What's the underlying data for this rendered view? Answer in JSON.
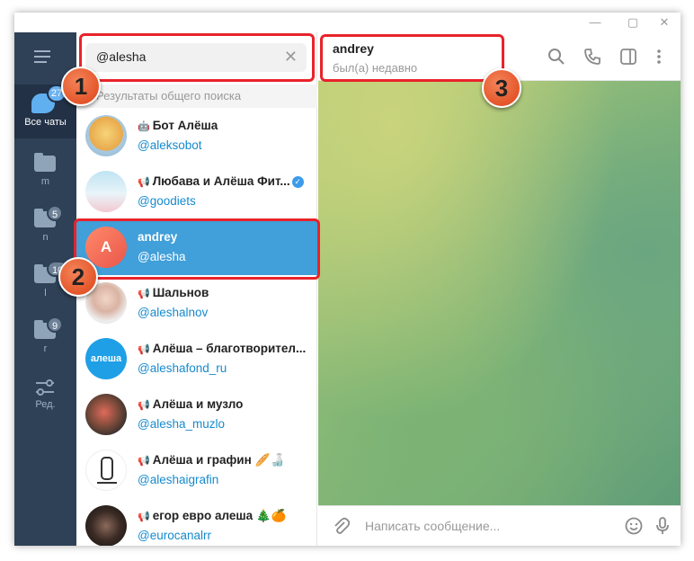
{
  "window": {
    "min_icon": "minimize-icon",
    "max_icon": "maximize-icon",
    "close_icon": "close-icon"
  },
  "folders": {
    "all_chats": {
      "label": "Все чаты",
      "badge": "27"
    },
    "items": [
      {
        "label": "m",
        "badge": ""
      },
      {
        "label": "n",
        "badge": "5"
      },
      {
        "label": "l",
        "badge": "10"
      },
      {
        "label": "r",
        "badge": "9"
      }
    ],
    "edit_label": "Ред."
  },
  "search": {
    "value": "@alesha",
    "section_title": "Результаты общего поиска"
  },
  "results": [
    {
      "name": "Бот Алёша",
      "username": "@aleksobot",
      "type": "bot"
    },
    {
      "name": "Любава и Алёша Фит...",
      "username": "@goodiets",
      "type": "channel",
      "verified": true
    },
    {
      "name": "andrey",
      "username": "@alesha",
      "type": "user",
      "avatar_letter": "A",
      "selected": true
    },
    {
      "name": "Шальнов",
      "username": "@aleshalnov",
      "type": "channel"
    },
    {
      "name": "Алёша – благотворител...",
      "username": "@aleshafond_ru",
      "type": "channel",
      "avatar_text": "алеша"
    },
    {
      "name": "Алёша и музло",
      "username": "@alesha_muzlo",
      "type": "channel"
    },
    {
      "name": "Алёша и графин 🥖🍶",
      "username": "@aleshaigrafin",
      "type": "channel"
    },
    {
      "name": "егор евро алеша 🎄🍊",
      "username": "@eurocanalrr",
      "type": "channel"
    }
  ],
  "chat": {
    "name": "andrey",
    "status": "был(а) недавно"
  },
  "composer": {
    "placeholder": "Написать сообщение..."
  },
  "annotations": [
    "1",
    "2",
    "3"
  ],
  "colors": {
    "accent": "#419fd9",
    "sidebar": "#2e4157",
    "highlight": "#e8232a",
    "link": "#168acd"
  }
}
